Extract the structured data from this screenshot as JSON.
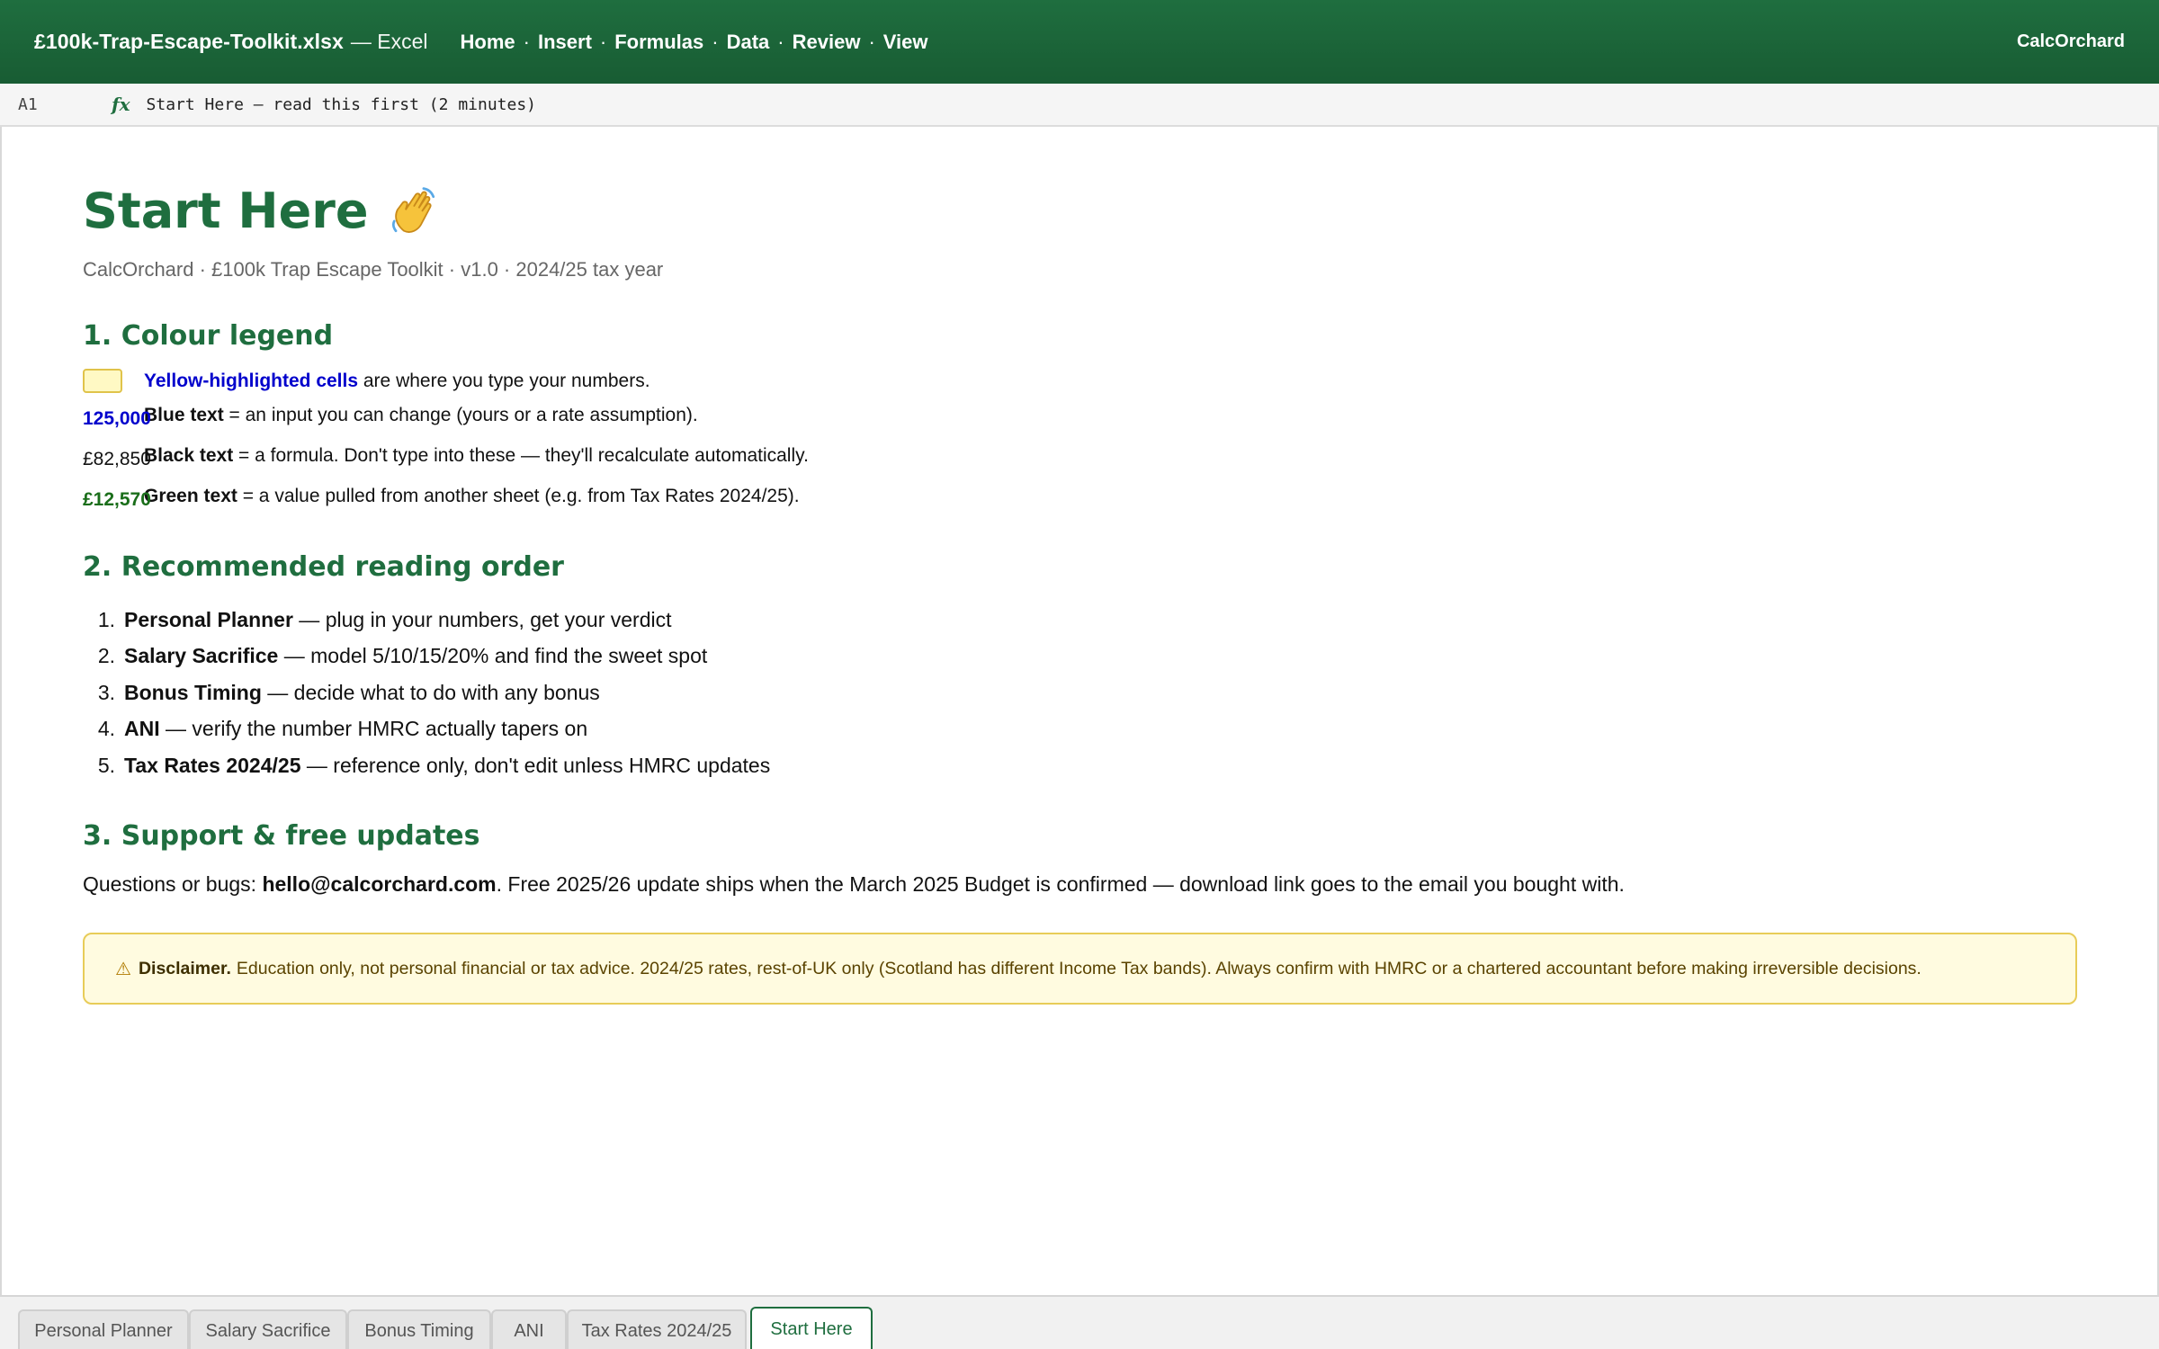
{
  "window": {
    "file_name": "£100k-Trap-Escape-Toolkit.xlsx",
    "app_name": "— Excel",
    "brand": "CalcOrchard"
  },
  "menu": {
    "items": [
      "Home",
      "Insert",
      "Formulas",
      "Data",
      "Review",
      "View"
    ],
    "separator": "·"
  },
  "formula_bar": {
    "cell_ref": "A1",
    "fx_label": "fx",
    "formula": "Start Here — read this first (2 minutes)"
  },
  "page": {
    "title": "Start Here",
    "title_icon": "waving-hand-icon",
    "subtitle": "CalcOrchard · £100k Trap Escape Toolkit · v1.0 · 2024/25 tax year"
  },
  "legend": {
    "heading": "1. Colour legend",
    "yellow": {
      "keyword": "Yellow-highlighted cells",
      "text": " are where you type your numbers."
    },
    "blue": {
      "sample": "125,000",
      "keyword": "Blue text",
      "text": " = an input you can change (yours or a rate assumption)."
    },
    "black": {
      "sample": "£82,850",
      "keyword": "Black text",
      "text": " = a formula. Don't type into these — they'll recalculate automatically."
    },
    "green": {
      "sample": "£12,570",
      "keyword": "Green text",
      "text": " = a value pulled from another sheet (e.g. from Tax Rates 2024/25)."
    }
  },
  "reading": {
    "heading": "2. Recommended reading order",
    "steps": [
      {
        "num": "1.",
        "name": "Personal Planner",
        "desc": " — plug in your numbers, get your verdict"
      },
      {
        "num": "2.",
        "name": "Salary Sacrifice",
        "desc": " — model 5/10/15/20% and find the sweet spot"
      },
      {
        "num": "3.",
        "name": "Bonus Timing",
        "desc": " — decide what to do with any bonus"
      },
      {
        "num": "4.",
        "name": "ANI",
        "desc": " — verify the number HMRC actually tapers on"
      },
      {
        "num": "5.",
        "name": "Tax Rates 2024/25",
        "desc": " — reference only, don't edit unless HMRC updates"
      }
    ]
  },
  "support": {
    "heading": "3. Support & free updates",
    "prefix": "Questions or bugs: ",
    "email": "hello@calcorchard.com",
    "suffix": ". Free 2025/26 update ships when the March 2025 Budget is confirmed — download link goes to the email you bought with."
  },
  "disclaimer": {
    "icon": "warning-icon",
    "title": "Disclaimer.",
    "text": "Education only, not personal financial or tax advice. 2024/25 rates, rest-of-UK only (Scotland has different Income Tax bands). Always confirm with HMRC or a chartered accountant before making irreversible decisions."
  },
  "sheet_tabs": {
    "tabs": [
      "Personal Planner",
      "Salary Sacrifice",
      "Bonus Timing",
      "ANI",
      "Tax Rates 2024/25",
      "Start Here"
    ],
    "active": "Start Here"
  },
  "colors": {
    "brand_green": "#1f6e3f",
    "input_blue": "#0000cc",
    "link_green": "#1a6e1a",
    "highlight_yellow": "#fff9c4"
  }
}
